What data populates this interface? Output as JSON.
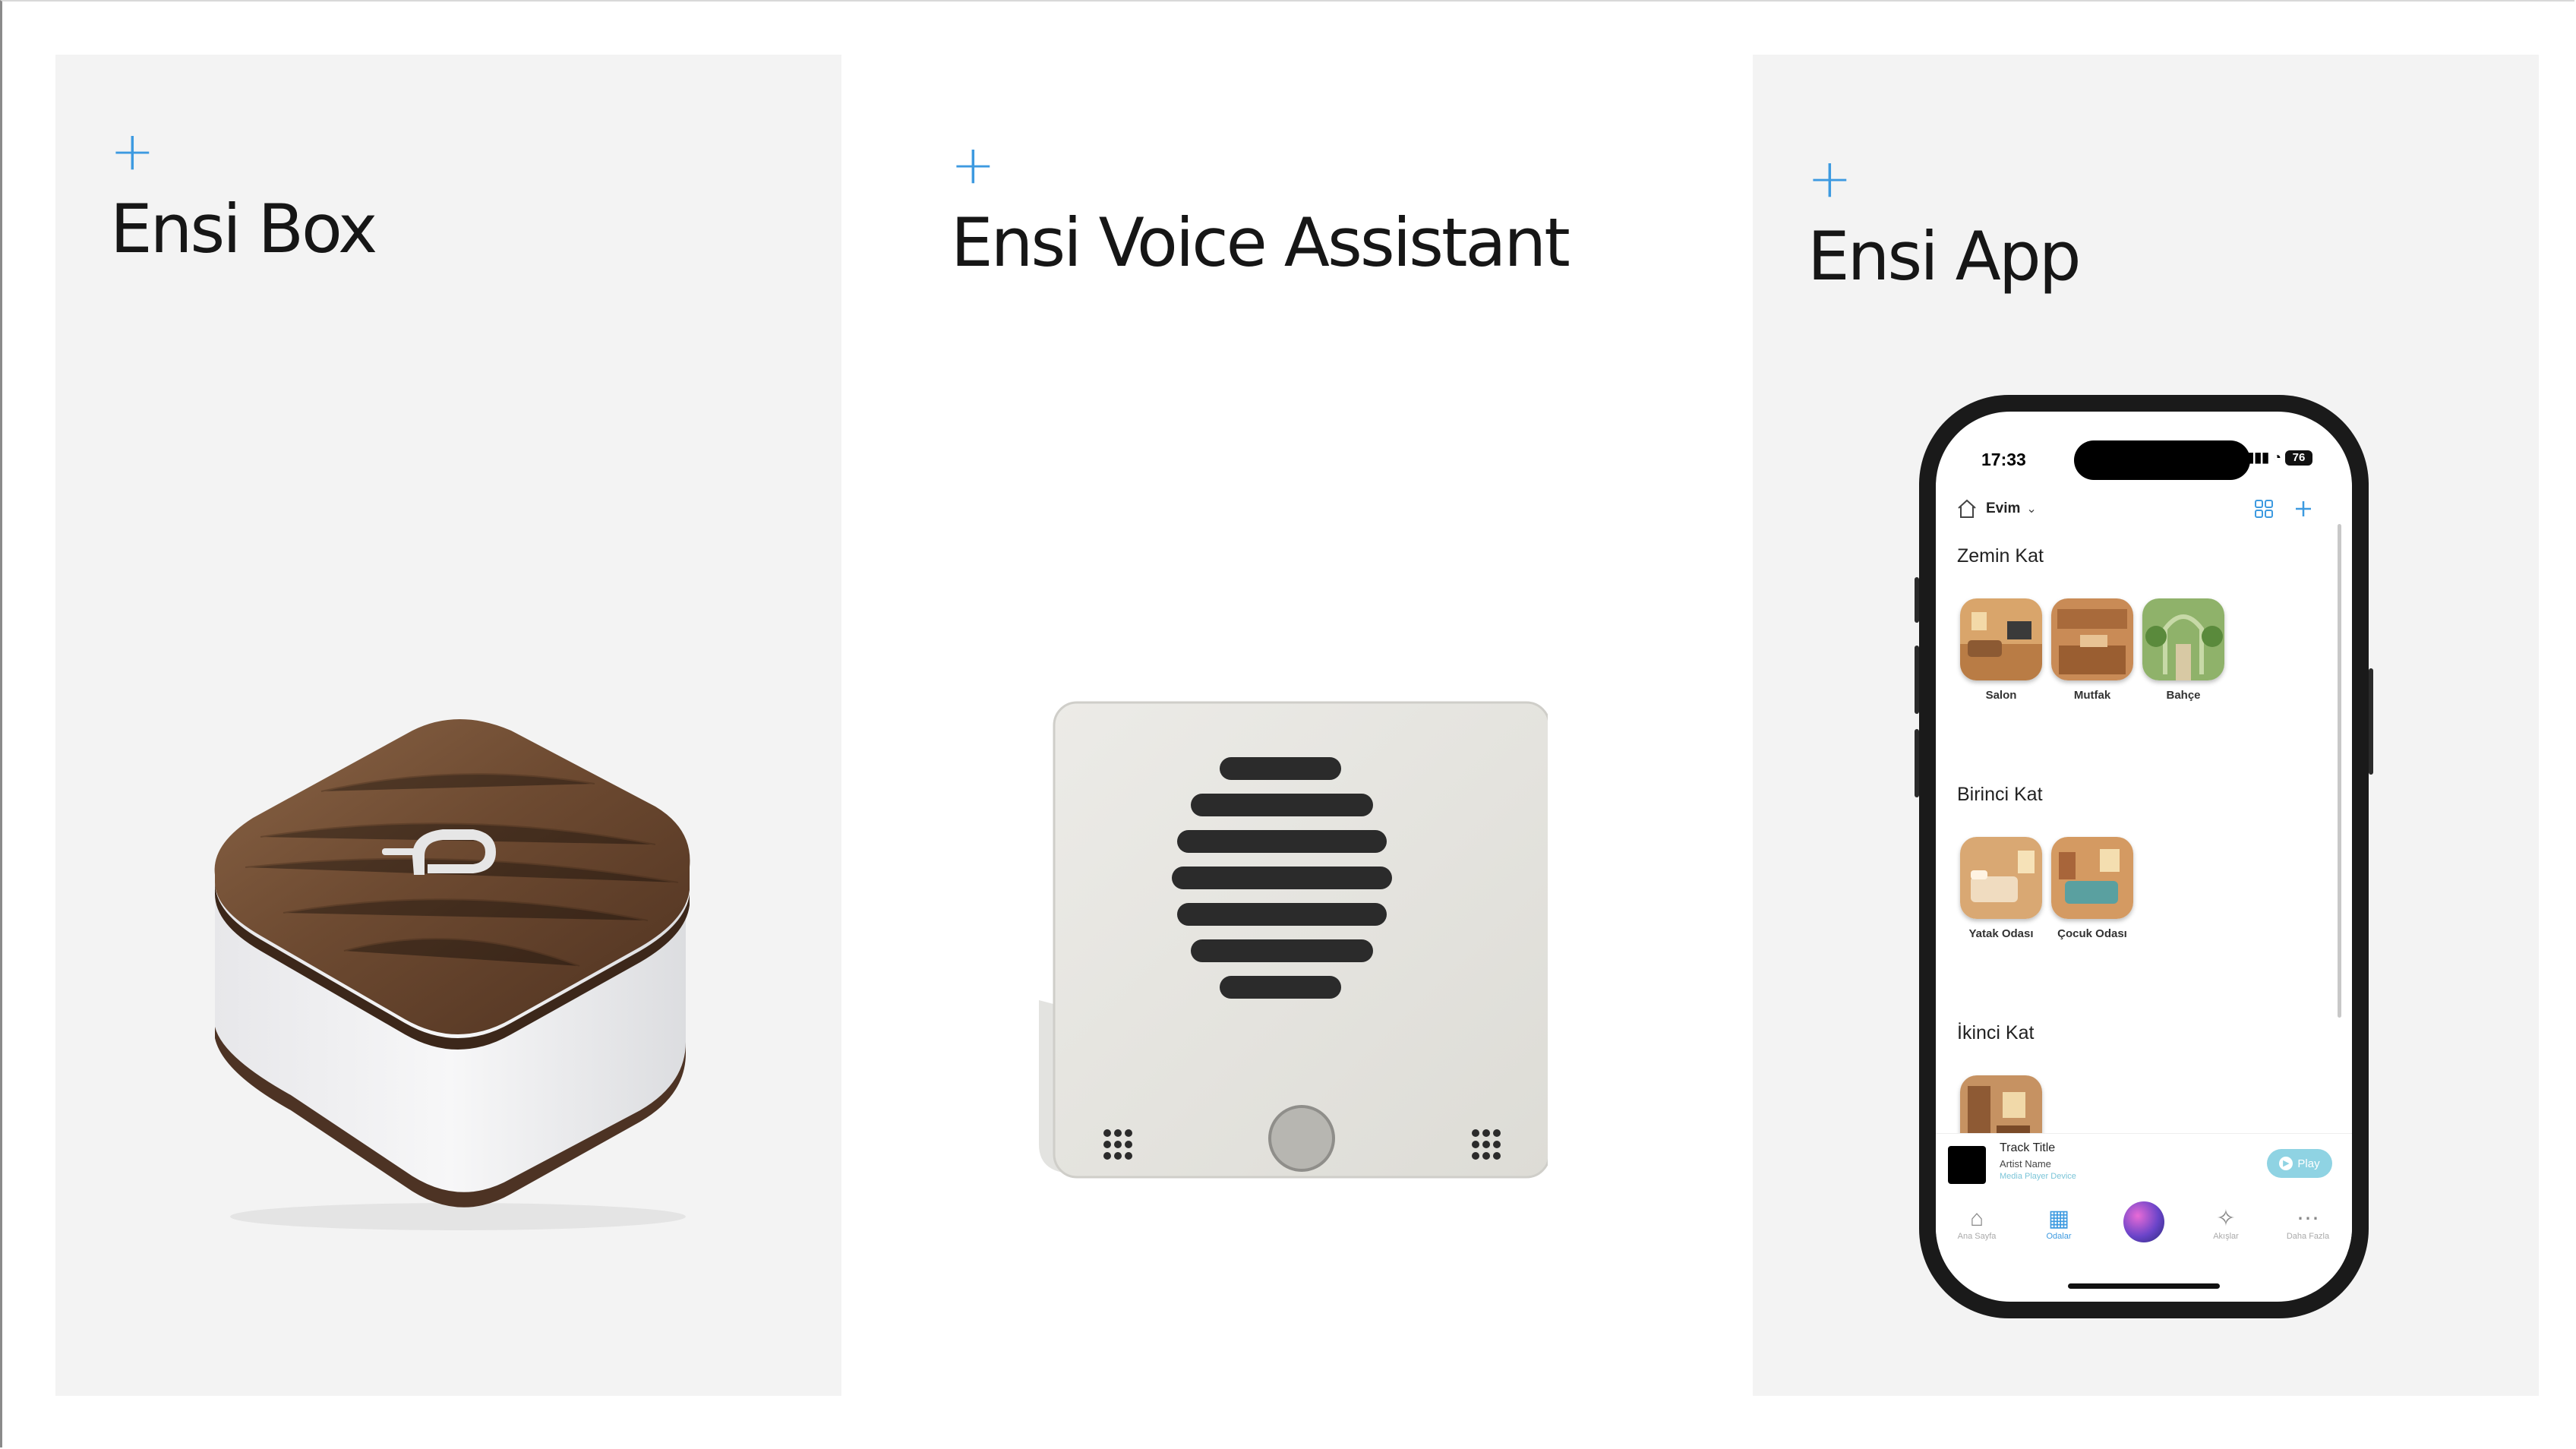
{
  "colors": {
    "accent": "#3d9ae0",
    "panel_bg": "#f3f3f3"
  },
  "panels": [
    {
      "plus": "+",
      "title": "Ensi Box"
    },
    {
      "plus": "+",
      "title": "Ensi Voice Assistant"
    },
    {
      "plus": "+",
      "title": "Ensi App"
    }
  ],
  "app": {
    "status_time": "17:33",
    "battery": "76",
    "home_name": "Evim",
    "sections": [
      {
        "title": "Zemin Kat",
        "rooms": [
          "Salon",
          "Mutfak",
          "Bahçe"
        ]
      },
      {
        "title": "Birinci Kat",
        "rooms": [
          "Yatak Odası",
          "Çocuk Odası"
        ]
      },
      {
        "title": "İkinci Kat",
        "rooms": [
          ""
        ]
      }
    ],
    "player": {
      "track": "Track Title",
      "artist": "Artist Name",
      "device": "Media Player Device",
      "play_label": "Play"
    },
    "tabs": [
      "Ana Sayfa",
      "Odalar",
      "",
      "Akışlar",
      "Daha Fazla"
    ]
  }
}
